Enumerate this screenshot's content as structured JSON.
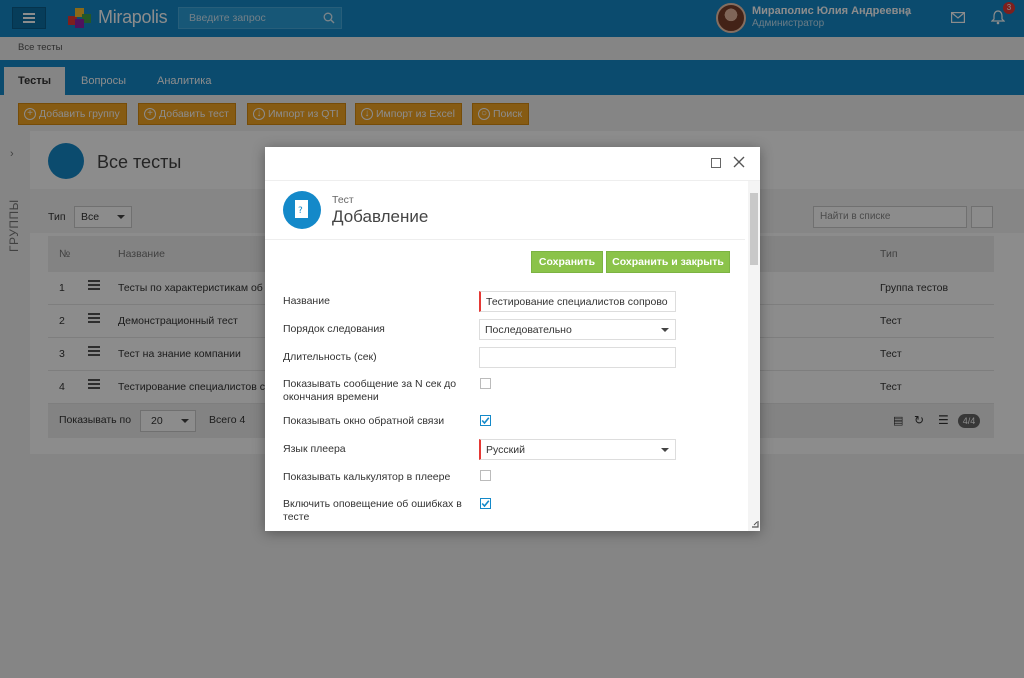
{
  "header": {
    "logo_text": "Mirapolis",
    "search_placeholder": "Введите запрос",
    "user_name": "Мираполис Юлия Андреевна",
    "user_role": "Администратор",
    "notifications_count": "3"
  },
  "breadcrumb": "Все тесты",
  "tabs": [
    {
      "label": "Тесты",
      "active": true
    },
    {
      "label": "Вопросы",
      "active": false
    },
    {
      "label": "Аналитика",
      "active": false
    }
  ],
  "toolbar": {
    "add_group": "Добавить группу",
    "add_test": "Добавить тест",
    "import_qti": "Импорт из QTI",
    "import_excel": "Импорт из Excel",
    "search": "Поиск"
  },
  "sidebar": {
    "groups_label": "ГРУППЫ"
  },
  "page": {
    "title": "Все тесты",
    "filter_label": "Тип",
    "filter_value": "Все",
    "list_search_placeholder": "Найти в списке"
  },
  "table": {
    "columns": {
      "num": "№",
      "name": "Название",
      "type": "Тип"
    },
    "rows": [
      {
        "num": "1",
        "name": "Тесты по характеристикам об",
        "type": "Группа тестов"
      },
      {
        "num": "2",
        "name": "Демонстрационный тест",
        "type": "Тест"
      },
      {
        "num": "3",
        "name": "Тест на знание компании",
        "type": "Тест"
      },
      {
        "num": "4",
        "name": "Тестирование специалистов с",
        "type": "Тест"
      }
    ]
  },
  "pager": {
    "show_label": "Показывать по",
    "page_size": "20",
    "total": "Всего 4",
    "count_badge": "4/4"
  },
  "dialog": {
    "subtitle": "Тест",
    "title": "Добавление",
    "save": "Сохранить",
    "save_close": "Сохранить и закрыть",
    "fields": {
      "name_label": "Название",
      "name_value": "Тестирование специалистов сопрово",
      "order_label": "Порядок следования",
      "order_value": "Последовательно",
      "duration_label": "Длительность (сек)",
      "duration_value": "",
      "show_msg_label": "Показывать сообщение за N сек до окончания времени",
      "feedback_label": "Показывать окно обратной связи",
      "lang_label": "Язык плеера",
      "lang_value": "Русский",
      "calc_label": "Показывать калькулятор в плеере",
      "errors_label": "Включить оповещение об ошибках в тесте"
    },
    "checkboxes": {
      "show_msg": false,
      "feedback": true,
      "calc": false,
      "errors": true
    }
  },
  "colors": {
    "brand_blue": "#1489c9",
    "toolbar_orange": "#f5a623",
    "save_green": "#8bc34a",
    "required_red": "#e53935"
  }
}
